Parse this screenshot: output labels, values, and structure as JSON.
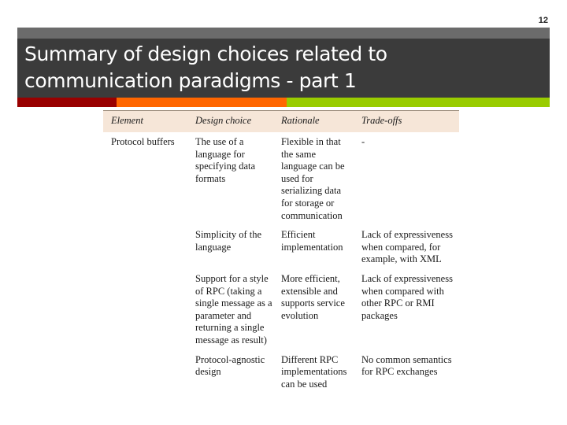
{
  "slide": {
    "page_number": "12",
    "title_line1": "Summary of design choices related to",
    "title_line2": "communication paradigms - part 1",
    "accent_colors": {
      "red": "#990000",
      "orange": "#ff6600",
      "green": "#99cc00",
      "band_dark": "#3b3b3b",
      "band_light": "#6b6b6b",
      "table_header_bg": "#f6e6d8"
    }
  },
  "table": {
    "headers": [
      "Element",
      "Design choice",
      "Rationale",
      "Trade-offs"
    ],
    "rows": [
      {
        "element": "Protocol buffers",
        "design_choice": "The use of a language for specifying data formats",
        "rationale": "Flexible in that the same language can be used for serializing data for storage or communication",
        "tradeoffs": "-"
      },
      {
        "element": "",
        "design_choice": "Simplicity of the language",
        "rationale": "Efficient implementation",
        "tradeoffs": "Lack of expressiveness when compared, for example, with XML"
      },
      {
        "element": "",
        "design_choice": "Support for a style of RPC (taking a single message as a parameter and returning a single message as result)",
        "rationale": "More efficient, extensible and supports service evolution",
        "tradeoffs": "Lack of expressiveness when compared with other RPC or RMI packages"
      },
      {
        "element": "",
        "design_choice": "Protocol-agnostic design",
        "rationale": "Different RPC implementations can be used",
        "tradeoffs": "No common semantics for RPC exchanges"
      }
    ]
  }
}
